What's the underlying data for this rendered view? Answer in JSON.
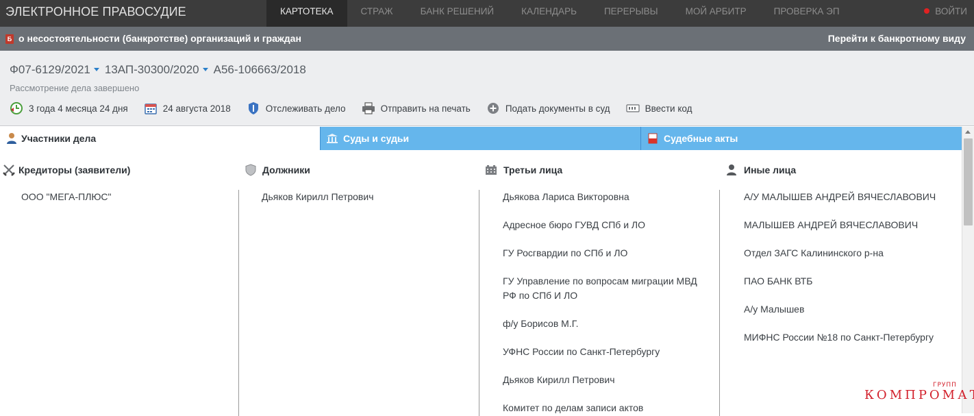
{
  "app": {
    "title": "ЭЛЕКТРОННОЕ ПРАВОСУДИЕ"
  },
  "nav": {
    "items": [
      {
        "label": "КАРТОТЕКА",
        "active": true
      },
      {
        "label": "СТРАЖ"
      },
      {
        "label": "БАНК РЕШЕНИЙ"
      },
      {
        "label": "КАЛЕНДАРЬ"
      },
      {
        "label": "ПЕРЕРЫВЫ"
      },
      {
        "label": "МОЙ АРБИТР"
      },
      {
        "label": "ПРОВЕРКА ЭП"
      }
    ],
    "login": "ВОЙТИ"
  },
  "case_type": {
    "badge": "Б",
    "title": "о несостоятельности (банкротстве) организаций и граждан",
    "link": "Перейти к банкротному виду"
  },
  "case": {
    "numbers": [
      "Ф07-6129/2021",
      "13АП-30300/2020",
      "А56-106663/2018"
    ],
    "status": "Рассмотрение дела завершено"
  },
  "actions": [
    {
      "label": "3 года 4 месяца 24 дня",
      "icon": "duration-icon"
    },
    {
      "label": "24 августа 2018",
      "icon": "calendar-icon"
    },
    {
      "label": "Отслеживать дело",
      "icon": "shield-icon"
    },
    {
      "label": "Отправить на печать",
      "icon": "printer-icon"
    },
    {
      "label": "Подать документы в суд",
      "icon": "plus-circle-icon"
    },
    {
      "label": "Ввести код",
      "icon": "code-icon"
    }
  ],
  "tabs": [
    {
      "label": "Участники дела",
      "icon": "person-icon",
      "active": true
    },
    {
      "label": "Суды и судьи",
      "icon": "courthouse-icon"
    },
    {
      "label": "Судебные акты",
      "icon": "pdf-icon"
    }
  ],
  "participants": {
    "creditors": {
      "title": "Кредиторы (заявители)",
      "icon": "swords-icon",
      "items": [
        "ООО \"МЕГА-ПЛЮС\""
      ]
    },
    "debtors": {
      "title": "Должники",
      "icon": "shield-icon",
      "items": [
        "Дьяков Кирилл Петрович"
      ]
    },
    "third": {
      "title": "Третьи лица",
      "icon": "building-icon",
      "items": [
        "Дьякова Лариса Викторовна",
        "Адресное бюро ГУВД СПб и ЛО",
        "ГУ Росгвардии по СПб и ЛО",
        "ГУ Управление по вопросам миграции МВД РФ по СПб И ЛО",
        "ф/у Борисов М.Г.",
        "УФНС России по Санкт-Петербургу",
        "Дьяков Кирилл Петрович",
        "Комитет по делам записи актов"
      ]
    },
    "others": {
      "title": "Иные лица",
      "icon": "person-icon",
      "items": [
        "А/У МАЛЫШЕВ АНДРЕЙ ВЯЧЕСЛАВОВИЧ",
        "МАЛЫШЕВ АНДРЕЙ ВЯЧЕСЛАВОВИЧ",
        "Отдел ЗАГС Калининского р-на",
        "ПАО БАНК ВТБ",
        "А/у Малышев",
        "МИФНС России №18 по Санкт-Петербургу"
      ]
    }
  },
  "watermark": {
    "text": "КОМПРОМАТ",
    "sup": "ГРУПП"
  }
}
